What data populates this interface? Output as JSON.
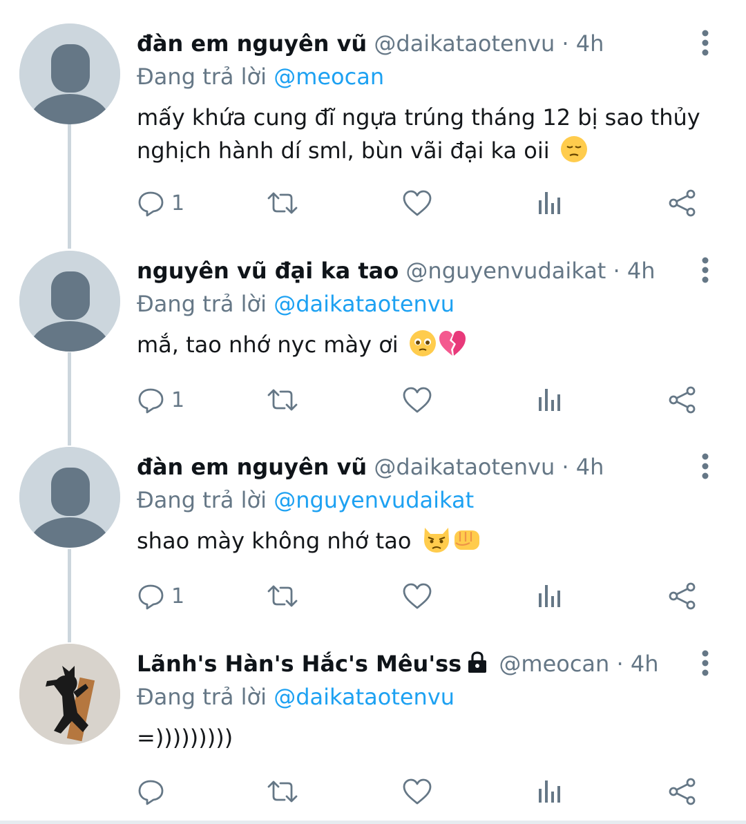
{
  "tweets": [
    {
      "name": "đàn em nguyên vũ",
      "handle": "@daikataotenvu",
      "separator": "·",
      "time": "4h",
      "replying_prefix": "Đang trả lời ",
      "replying_to": "@meocan",
      "text": "mấy khứa cung đĩ ngựa trúng tháng 12 bị sao thủy nghịch hành dí sml, bùn vãi đại ka oii",
      "emoji": [
        "pensive-face"
      ],
      "reply_count": "1",
      "avatar": "default-avatar"
    },
    {
      "name": "nguyên vũ đại ka tao",
      "handle": "@nguyenvudaikat",
      "separator": "·",
      "time": "4h",
      "replying_prefix": "Đang trả lời ",
      "replying_to": "@daikataotenvu",
      "text": "mắ, tao nhớ nyc mày ơi",
      "emoji": [
        "pleading-face",
        "broken-heart"
      ],
      "reply_count": "1",
      "avatar": "default-avatar"
    },
    {
      "name": "đàn em nguyên vũ",
      "handle": "@daikataotenvu",
      "separator": "·",
      "time": "4h",
      "replying_prefix": "Đang trả lời ",
      "replying_to": "@nguyenvudaikat",
      "text": "shao mày không nhớ tao",
      "emoji": [
        "pouting-cat",
        "oncoming-fist"
      ],
      "reply_count": "1",
      "avatar": "default-avatar"
    },
    {
      "name": "Lãnh's Hàn's Hắc's Mêu'ss",
      "handle": "@meocan",
      "separator": "·",
      "time": "4h",
      "replying_prefix": "Đang trả lời ",
      "replying_to": "@daikataotenvu",
      "text": "=)))))))))",
      "emoji": [],
      "reply_count": "",
      "avatar": "black-cat-photo",
      "protected": "lock-icon"
    }
  ],
  "icons": {
    "reply": "reply-icon",
    "retweet": "retweet-icon",
    "like": "like-icon",
    "analytics": "analytics-icon",
    "share": "share-icon",
    "more": "more-vertical-icon"
  },
  "colors": {
    "text": "#0f1419",
    "secondary": "#657786",
    "link": "#1da1f2",
    "thread_line": "#ccd6dd",
    "avatar_bg": "#ccd6dd",
    "avatar_fg": "#657786"
  }
}
